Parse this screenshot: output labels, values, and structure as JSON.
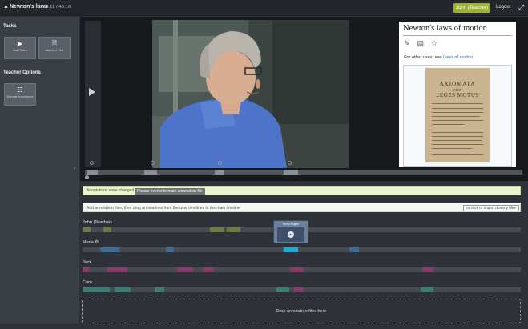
{
  "header": {
    "title": "Newton's laws",
    "time": "04:11 / 48:16",
    "user_button": "John (Teacher)",
    "logout": "Logout"
  },
  "sidebar": {
    "tasks_heading": "Tasks",
    "tasks": [
      {
        "label": "Start Video",
        "icon": "play-icon"
      },
      {
        "label": "Attached Files",
        "icon": "file-add-icon"
      }
    ],
    "teacher_heading": "Teacher Options",
    "teacher_items": [
      {
        "label": "Manage Annotations",
        "icon": "tree-icon"
      }
    ]
  },
  "wiki": {
    "title": "Newton's laws of motion",
    "hatnote_prefix": "For other uses, see ",
    "hatnote_link": "Laws of motion",
    "hatnote_suffix": ".",
    "scan_title": "AXIOMATA",
    "scan_sub": "SIVE",
    "scan_title2": "LEGES MOTUS"
  },
  "notices": {
    "changed_msg": "Annotations were changed.",
    "overwrite_button": "Please overwrite main annotation file",
    "add_msg": "Add annotation files, then drag annotations from the user timelines to the main timeline",
    "import_button": "or click to import dummy files"
  },
  "tracks": [
    {
      "name": "John (Teacher)"
    },
    {
      "name": "Maria"
    },
    {
      "name": "Jack"
    },
    {
      "name": "Caro"
    }
  ],
  "tooltip": {
    "title": "Henry Engine"
  },
  "dropzone": {
    "label": "Drop annotation files here"
  },
  "colors": {
    "accent": "#9fb133",
    "track_bg": "#474c53",
    "annot_olive": "#6e7a45",
    "annot_teal": "#3c7c73",
    "annot_magenta": "#8b3c6e",
    "annot_cyan": "#1fa9d6",
    "annot_blue": "#3c6d95"
  }
}
